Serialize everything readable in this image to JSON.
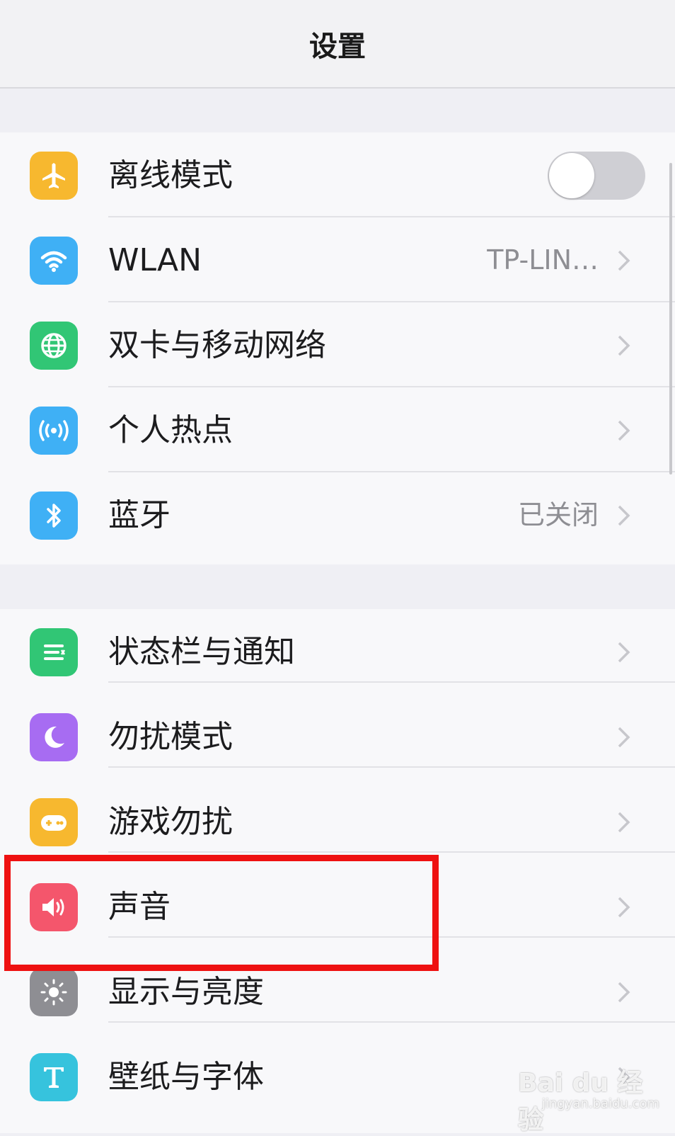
{
  "header": {
    "title": "设置"
  },
  "network": {
    "airplane": {
      "label": "离线模式",
      "on": false,
      "icon": "airplane-icon",
      "color": "#f7b82f"
    },
    "wlan": {
      "label": "WLAN",
      "value": "TP-LIN…",
      "icon": "wifi-icon",
      "color": "#3fb0f5"
    },
    "mobile": {
      "label": "双卡与移动网络",
      "icon": "globe-icon",
      "color": "#31c675"
    },
    "hotspot": {
      "label": "个人热点",
      "icon": "hotspot-icon",
      "color": "#3fb0f5"
    },
    "bluetooth": {
      "label": "蓝牙",
      "value": "已关闭",
      "icon": "bluetooth-icon",
      "color": "#3fb0f5"
    }
  },
  "system": {
    "statusbar": {
      "label": "状态栏与通知",
      "icon": "notification-list-icon",
      "color": "#31c675"
    },
    "dnd": {
      "label": "勿扰模式",
      "icon": "moon-icon",
      "color": "#a76cf2"
    },
    "game": {
      "label": "游戏勿扰",
      "icon": "gamepad-icon",
      "color": "#f7b82f"
    },
    "sound": {
      "label": "声音",
      "icon": "speaker-icon",
      "color": "#f4566c"
    },
    "display": {
      "label": "显示与亮度",
      "icon": "sun-icon",
      "color": "#8e8e93"
    },
    "wallpaper": {
      "label": "壁纸与字体",
      "icon": "font-t-icon",
      "color": "#36c3dd"
    }
  },
  "highlight_color": "#ee1111",
  "watermark": {
    "main": "Bai du 经验",
    "sub": "jingyan.baidu.com"
  }
}
